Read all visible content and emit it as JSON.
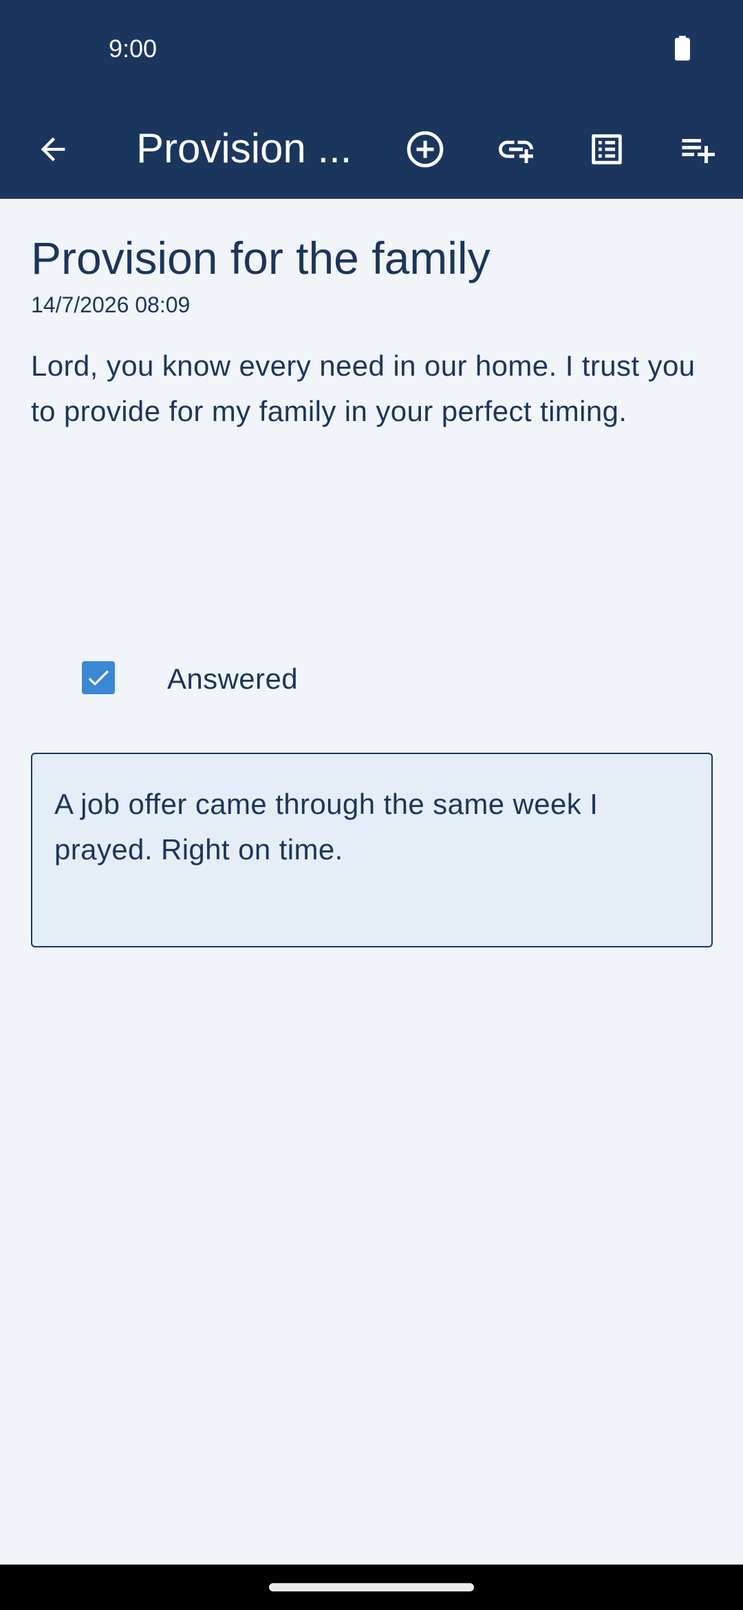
{
  "status_bar": {
    "time": "9:00",
    "battery_icon": "battery-full-icon"
  },
  "app_bar": {
    "title": "Provision ...",
    "icons": {
      "back": "arrow-back-icon",
      "add": "add-circle-icon",
      "link": "add-link-icon",
      "list": "list-alt-icon",
      "playlist": "playlist-add-icon"
    }
  },
  "prayer": {
    "title": "Provision for the family",
    "date": "14/7/2026 08:09",
    "body": "Lord, you know every need in our home. I trust you to provide for my family in your perfect timing.",
    "answered_label": "Answered",
    "answered": true,
    "answer_text": "A job offer came through the same week I prayed. Right on time."
  },
  "colors": {
    "app_bar_bg": "#1b365d",
    "page_bg": "#f1f5fa",
    "text": "#1c3559",
    "checkbox": "#3a87d4",
    "answer_box_bg": "#e5edf7"
  }
}
